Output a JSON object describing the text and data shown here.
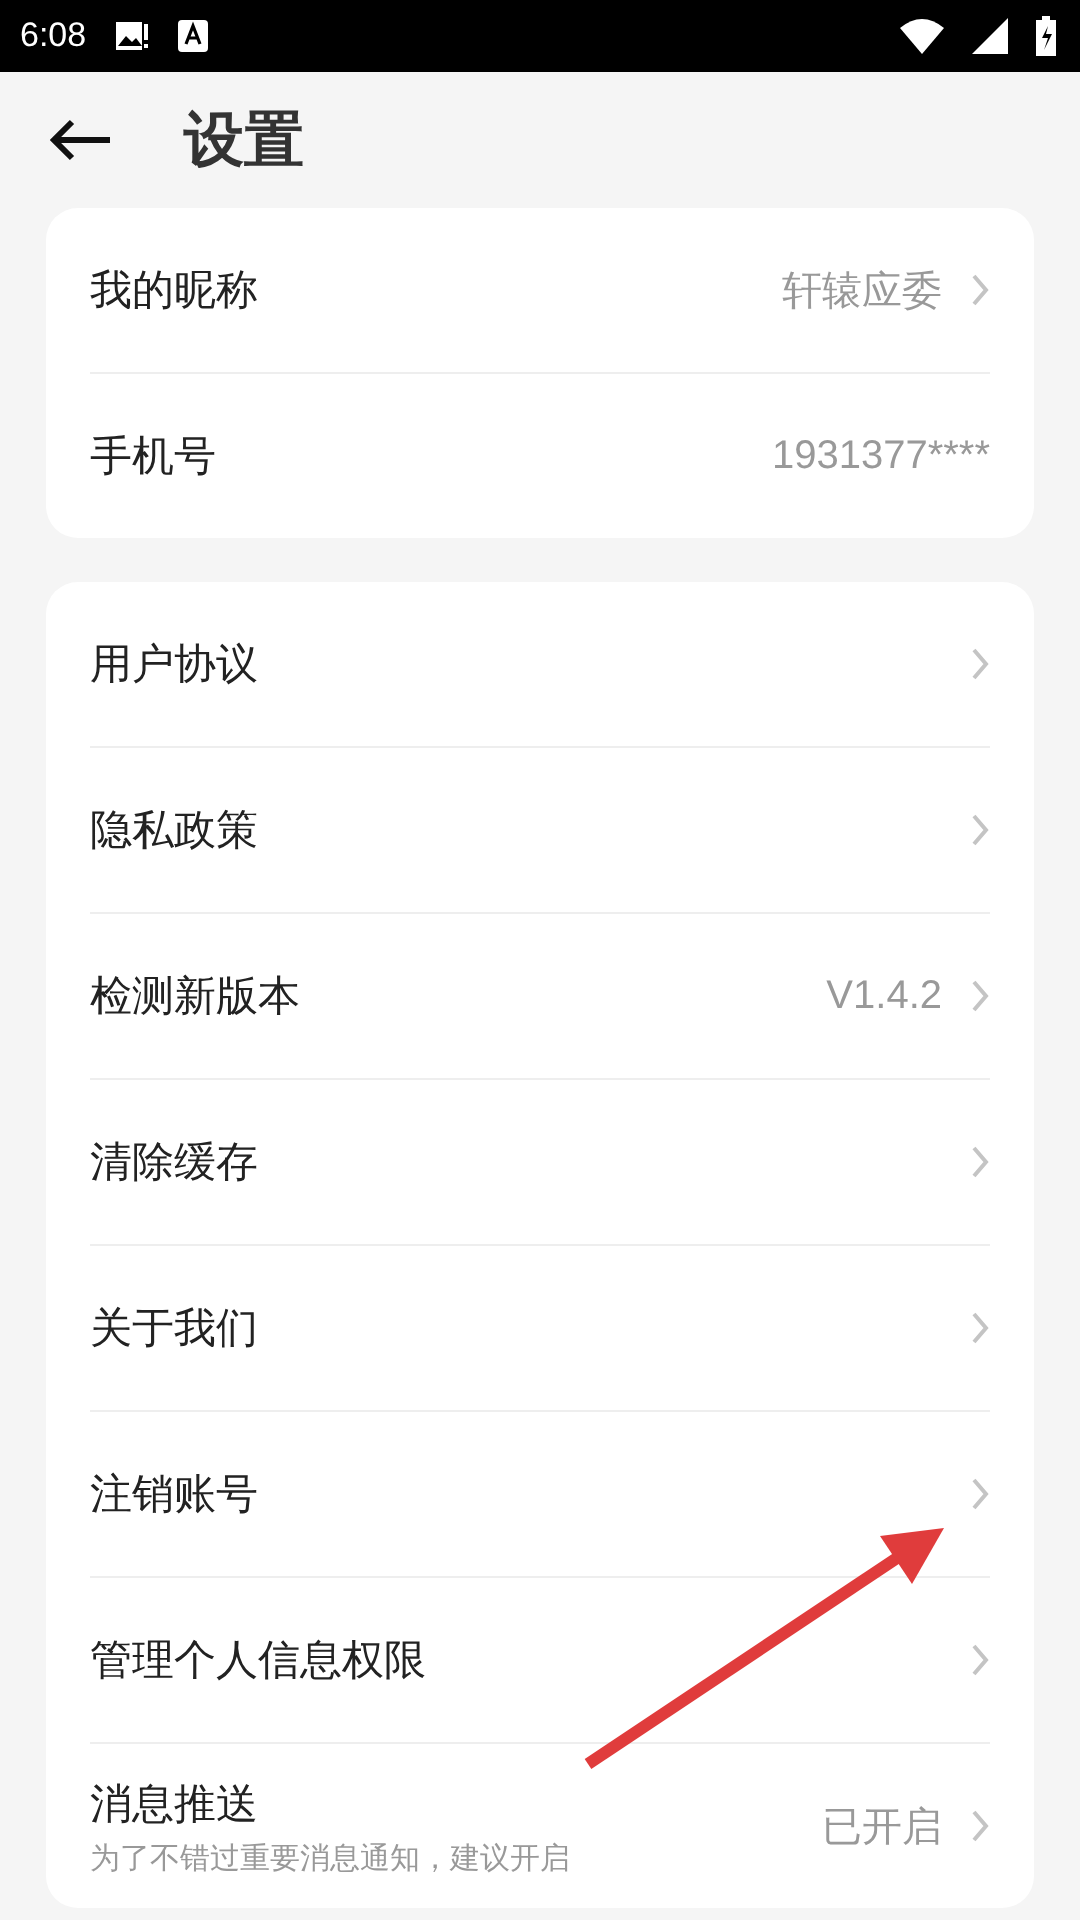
{
  "status_bar": {
    "time": "6:08"
  },
  "header": {
    "title": "设置"
  },
  "sections": [
    {
      "rows": [
        {
          "label": "我的昵称",
          "value": "轩辕应委",
          "chevron": true
        },
        {
          "label": "手机号",
          "value": "1931377****",
          "chevron": false
        }
      ]
    },
    {
      "rows": [
        {
          "label": "用户协议",
          "chevron": true
        },
        {
          "label": "隐私政策",
          "chevron": true
        },
        {
          "label": "检测新版本",
          "value": "V1.4.2",
          "chevron": true
        },
        {
          "label": "清除缓存",
          "chevron": true
        },
        {
          "label": "关于我们",
          "chevron": true
        },
        {
          "label": "注销账号",
          "chevron": true
        },
        {
          "label": "管理个人信息权限",
          "chevron": true
        },
        {
          "label": "消息推送",
          "subtitle": "为了不错过重要消息通知，建议开启",
          "value": "已开启",
          "chevron": true
        }
      ]
    }
  ]
}
